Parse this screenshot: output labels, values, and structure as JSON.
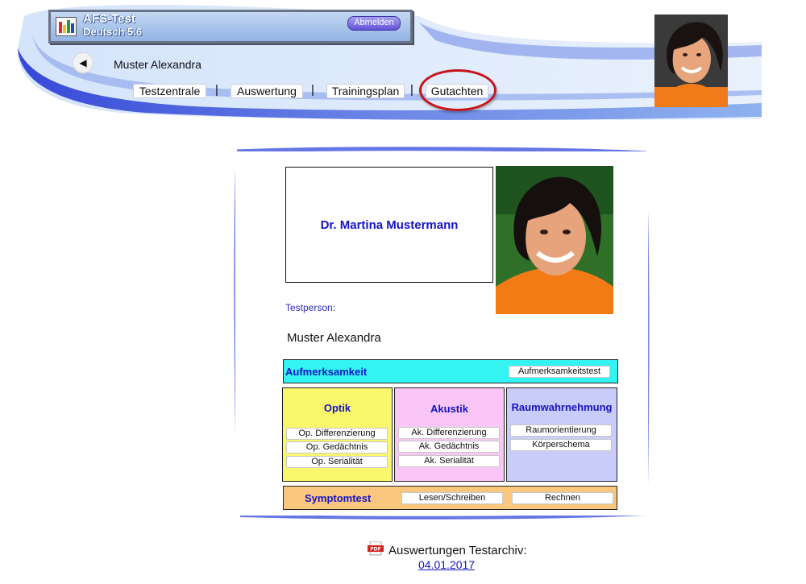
{
  "app": {
    "title": "AFS-Test",
    "subtitle": "Deutsch 5.6",
    "logout_label": "Abmelden"
  },
  "header": {
    "user_name": "Muster Alexandra",
    "nav": [
      {
        "label": "Testzentrale"
      },
      {
        "label": "Auswertung"
      },
      {
        "label": "Trainingsplan"
      },
      {
        "label": "Gutachten"
      }
    ],
    "separator": "|",
    "highlighted_tab": "Gutachten"
  },
  "card": {
    "doctor_name": "Dr. Martina Mustermann",
    "testperson_label": "Testperson:",
    "testperson_name": "Muster Alexandra",
    "aufmerksamkeit": {
      "title": "Aufmerksamkeit",
      "buttons": [
        "Aufmerksamkeitstest"
      ]
    },
    "optik": {
      "title": "Optik",
      "buttons": [
        "Op. Differenzierung",
        "Op. Gedächtnis",
        "Op. Serialität"
      ]
    },
    "akustik": {
      "title": "Akustik",
      "buttons": [
        "Ak. Differenzierung",
        "Ak. Gedächtnis",
        "Ak. Serialität"
      ]
    },
    "raum": {
      "title": "Raumwahrnehmung",
      "buttons": [
        "Raumorientierung",
        "Körperschema"
      ]
    },
    "symptom": {
      "title": "Symptomtest",
      "buttons": [
        "Lesen/Schreiben",
        "Rechnen"
      ]
    }
  },
  "archive": {
    "label": "Auswertungen Testarchiv:",
    "date_link": "04.01.2017",
    "icon_text": "PDF"
  },
  "colors": {
    "accent_blue": "#1313c7",
    "highlight_red": "#c8151b",
    "aufmerksamkeit_bg": "#33f3f3",
    "optik_bg": "#fbf76c",
    "akustik_bg": "#f9c6f6",
    "raum_bg": "#c9ccf9",
    "symptom_bg": "#f9c77d"
  }
}
